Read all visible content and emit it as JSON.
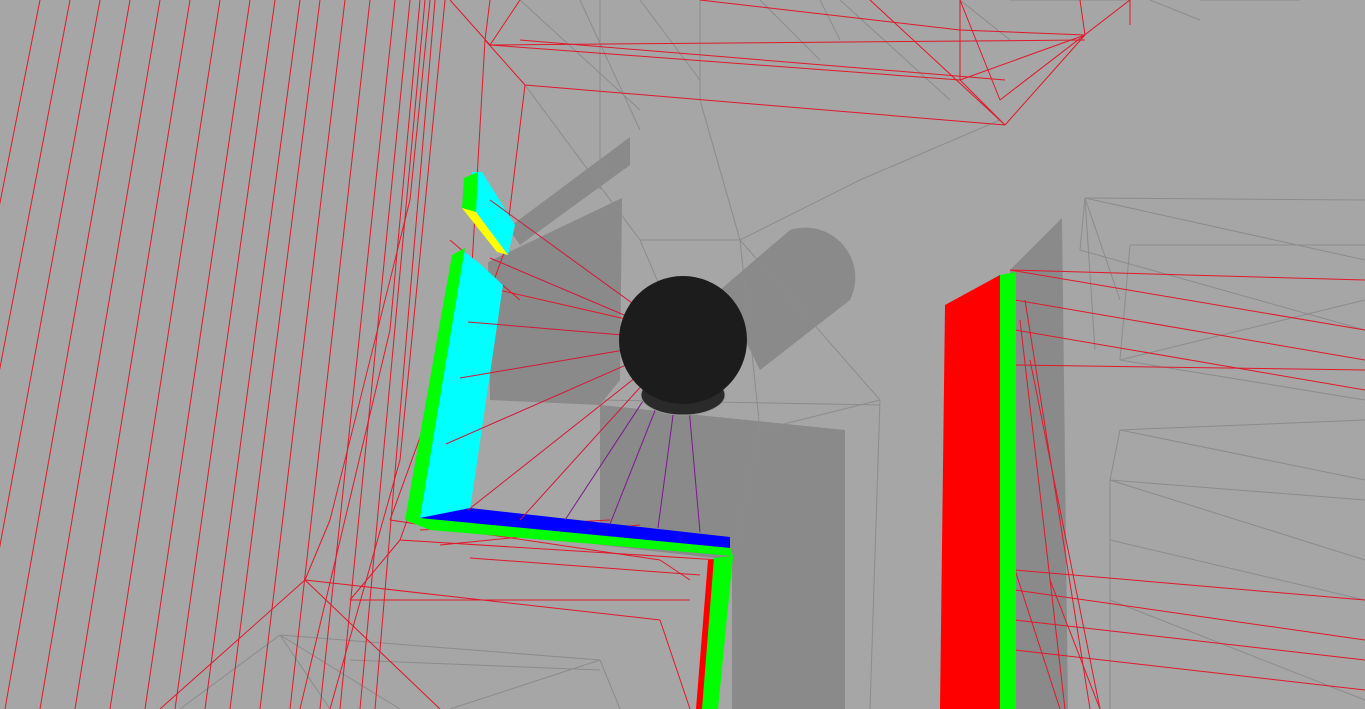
{
  "scene": {
    "background_color": "#a6a6a6",
    "shadow_color": "#8a8a8a",
    "robot_color": "#1c1c1c",
    "mesh_red": "#e0192b",
    "mesh_gray": "#8c8c8c",
    "ray_red": "#d4173a",
    "ray_purple": "#7a1a8c",
    "wall_colors": [
      "#ff0000",
      "#00ff00",
      "#0000ff",
      "#00ffff",
      "#ffff00"
    ]
  }
}
